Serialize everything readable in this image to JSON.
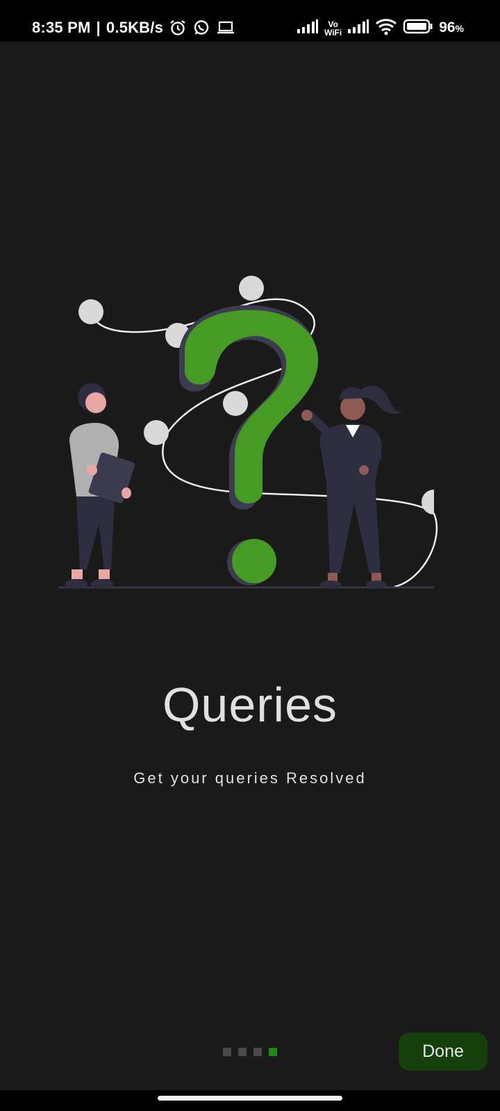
{
  "status_bar": {
    "time": "8:35 PM",
    "network_speed": "0.5KB/s",
    "separator": "|",
    "vowifi_top": "Vo",
    "vowifi_bottom": "WiFi",
    "battery_percent": "96",
    "battery_unit": "%",
    "icons": [
      "alarm-icon",
      "whatsapp-icon",
      "laptop-icon",
      "signal-icon",
      "vowifi-icon",
      "signal-icon",
      "wifi-icon",
      "battery-icon"
    ]
  },
  "onboarding": {
    "illustration": "queries-illustration",
    "title": "Queries",
    "subtitle": "Get your queries Resolved",
    "page_count": 4,
    "current_page": 4,
    "done_label": "Done"
  },
  "colors": {
    "background": "#1a1a1a",
    "accent_green": "#459b24",
    "active_dot": "#1f8b16",
    "done_button": "#153f0b"
  }
}
